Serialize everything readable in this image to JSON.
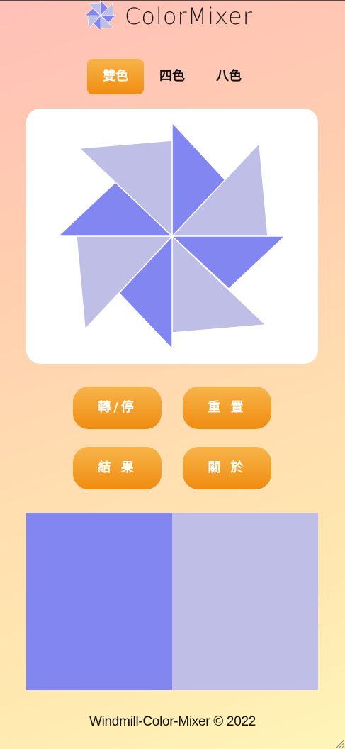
{
  "app": {
    "title": "ColorMixer"
  },
  "tabs": [
    {
      "label": "雙色",
      "active": true
    },
    {
      "label": "四色",
      "active": false
    },
    {
      "label": "八色",
      "active": false
    }
  ],
  "colors": {
    "primary": "#8286f0",
    "secondary": "#bebee6",
    "accent_start": "#f7b44a",
    "accent_end": "#f08c10"
  },
  "buttons": {
    "spin_stop": "轉/停",
    "reset": "重 置",
    "result": "結 果",
    "about": "關 於"
  },
  "footer": {
    "text": "Windmill-Color-Mixer © 2022"
  }
}
